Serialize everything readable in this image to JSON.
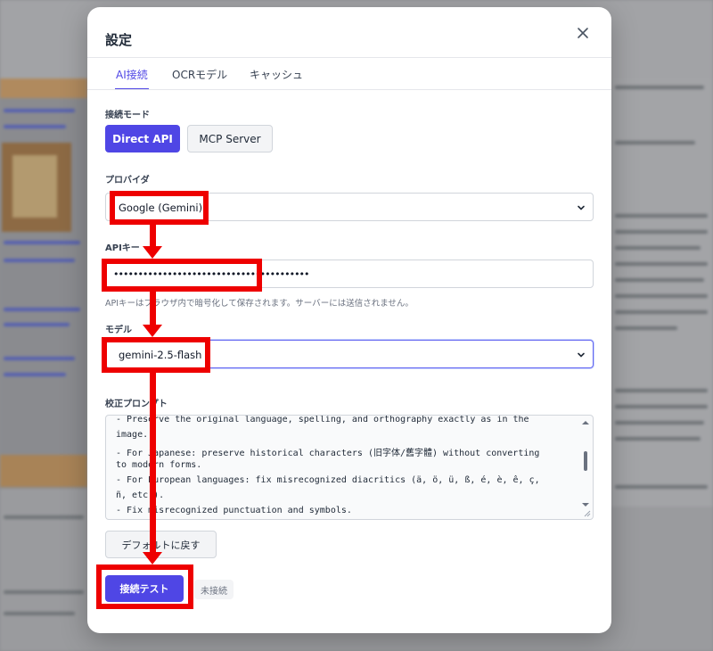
{
  "modal": {
    "title": "設定",
    "close_icon": "close-icon"
  },
  "tabs": [
    {
      "label": "AI接続",
      "active": true
    },
    {
      "label": "OCRモデル",
      "active": false
    },
    {
      "label": "キャッシュ",
      "active": false
    }
  ],
  "connection_mode": {
    "label": "接続モード",
    "options": [
      "Direct API",
      "MCP Server"
    ],
    "selected": "Direct API"
  },
  "provider": {
    "label": "プロバイダ",
    "value": "Google (Gemini)"
  },
  "api_key": {
    "label": "APIキー",
    "value": "••••••••••••••••••••••••••••••••••••••••",
    "hint": "APIキーはブラウザ内で暗号化して保存されます。サーバーには送信されません。"
  },
  "model": {
    "label": "モデル",
    "value": "gemini-2.5-flash"
  },
  "prompt": {
    "label": "校正プロンプト",
    "lines": [
      "- Preserve the original language, spelling, and orthography exactly as in the",
      "image.",
      "- For Japanese: preserve historical characters (旧字体/舊字體) without converting",
      "to modern forms.",
      "- For European languages: fix misrecognized diacritics (ä, ö, ü, ß, é, è, ê, ç,",
      "ñ, etc.).",
      "- Fix misrecognized punctuation and symbols."
    ]
  },
  "buttons": {
    "reset_default": "デフォルトに戻す",
    "connection_test": "接続テスト"
  },
  "status": {
    "text": "未接続"
  },
  "colors": {
    "accent": "#4f46e5",
    "annotation": "#ee0000"
  }
}
